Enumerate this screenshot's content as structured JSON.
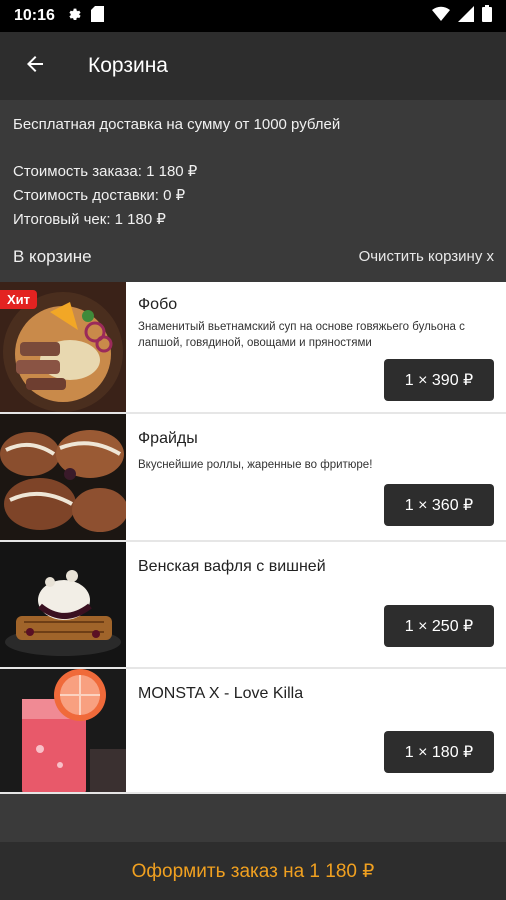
{
  "status_bar": {
    "time": "10:16",
    "icons_left": [
      "gear-icon",
      "sd-card-icon"
    ],
    "icons_right": [
      "wifi-icon",
      "signal-icon",
      "battery-icon"
    ]
  },
  "header": {
    "title": "Корзина",
    "back_icon": "arrow-left-icon"
  },
  "summary": {
    "free_delivery": "Бесплатная доставка на сумму от 1000 рублей",
    "order_cost": "Стоимость заказа: 1 180 ₽",
    "delivery_cost": "Стоимость доставки: 0 ₽",
    "total": "Итоговый чек: 1 180 ₽",
    "in_cart_label": "В корзине",
    "clear_cart": "Очистить корзину x"
  },
  "items": [
    {
      "name": "Фобо",
      "description": "Знаменитый вьетнамский суп на основе говяжьего бульона с лапшой, говядиной, овощами и пряностями",
      "qty_price": "1 × 390 ₽",
      "badge": "Хит"
    },
    {
      "name": "Фрайды",
      "description": "Вкуснейшие роллы, жаренные во фритюре!",
      "qty_price": "1 × 360 ₽"
    },
    {
      "name": "Венская вафля с вишней",
      "description": "",
      "qty_price": "1 × 250 ₽"
    },
    {
      "name": "MONSTA X - Love Killa",
      "description": "",
      "qty_price": "1 × 180 ₽"
    }
  ],
  "checkout": {
    "label": "Оформить заказ на 1 180 ₽"
  },
  "colors": {
    "accent": "#f0a020",
    "badge": "#e32321",
    "dark_button": "#2d2d2d"
  }
}
